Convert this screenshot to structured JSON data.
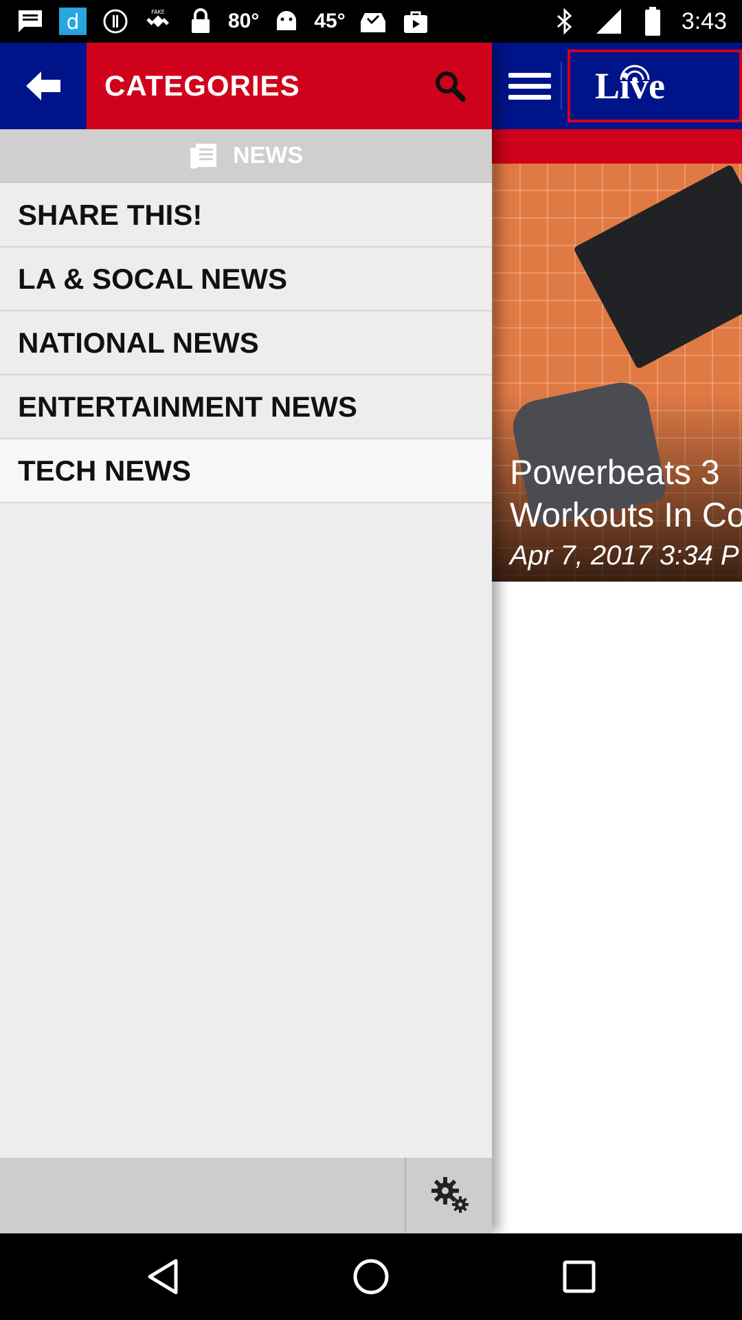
{
  "status_bar": {
    "temp1": "80°",
    "temp2": "45°",
    "time": "3:43",
    "icons": [
      "message-icon",
      "app-d-icon",
      "info-icon",
      "fake-gps-icon",
      "lock-icon",
      "android-icon",
      "inbox-check-icon",
      "shopping-bag-icon",
      "bluetooth-icon",
      "signal-icon",
      "battery-icon"
    ]
  },
  "drawer": {
    "title": "CATEGORIES",
    "section_label": "NEWS",
    "items": [
      {
        "label": "SHARE THIS!"
      },
      {
        "label": "LA & SOCAL NEWS"
      },
      {
        "label": "NATIONAL NEWS"
      },
      {
        "label": "ENTERTAINMENT NEWS"
      },
      {
        "label": "TECH NEWS"
      }
    ]
  },
  "background_app": {
    "live_label": "Live",
    "article": {
      "title_line1": "Powerbeats 3",
      "title_line2": "Workouts In Co",
      "date": "Apr 7, 2017 3:34 P"
    }
  },
  "colors": {
    "brand_red": "#d0021b",
    "brand_blue": "#00148a",
    "drawer_bg": "#ededed"
  }
}
